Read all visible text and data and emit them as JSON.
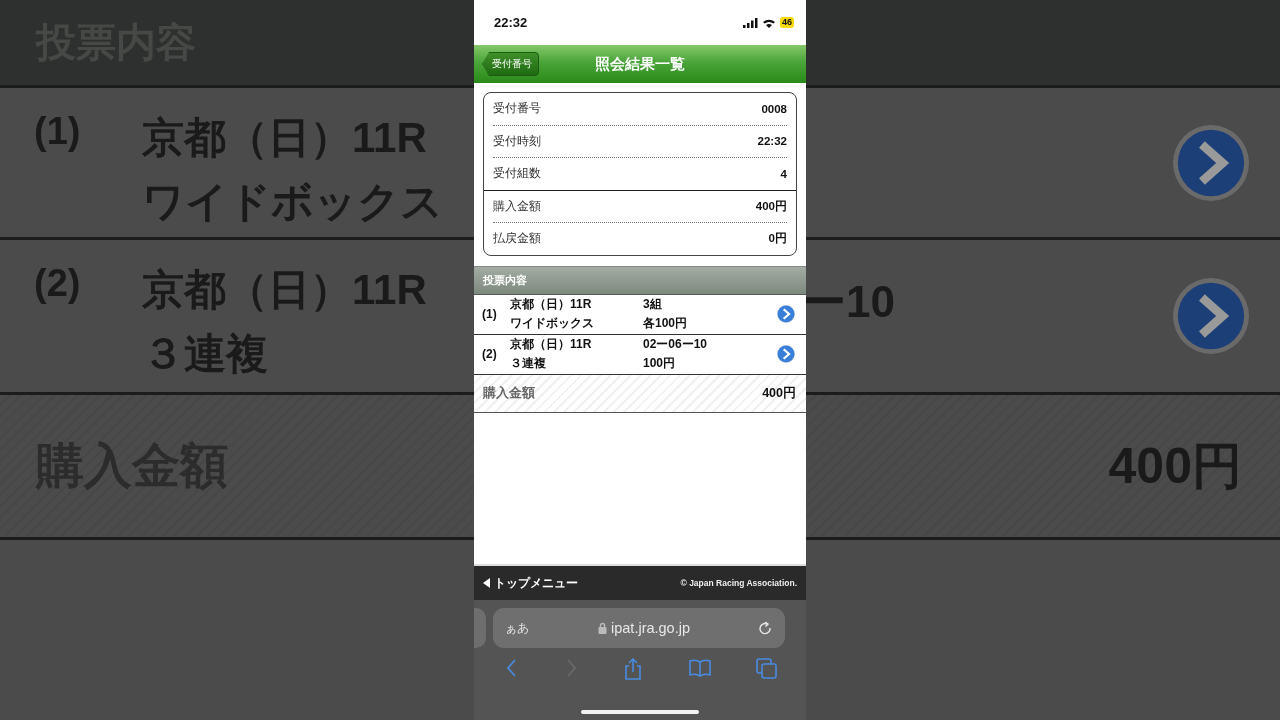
{
  "backdrop": {
    "left": {
      "header": "投票内容",
      "bets": [
        {
          "number": "(1)",
          "lines": [
            "京都（日）11R",
            "ワイドボックス"
          ]
        },
        {
          "number": "(2)",
          "lines": [
            "京都（日）11R",
            "３連複"
          ]
        }
      ],
      "total_label": "購入金額"
    },
    "right": {
      "second_bet_fragment": "ー10",
      "total_amount": "400円"
    }
  },
  "status_bar": {
    "time": "22:32",
    "battery": "46"
  },
  "nav_bar": {
    "back": "受付番号",
    "title": "照会結果一覧"
  },
  "summary": {
    "groups": [
      [
        {
          "label": "受付番号",
          "value": "0008"
        },
        {
          "label": "受付時刻",
          "value": "22:32"
        },
        {
          "label": "受付組数",
          "value": "4"
        }
      ],
      [
        {
          "label": "購入金額",
          "value": "400円"
        },
        {
          "label": "払戻金額",
          "value": "0円"
        }
      ]
    ]
  },
  "section_header": "投票内容",
  "bets": [
    {
      "number": "(1)",
      "venue": "京都（日）11R",
      "type": "ワイドボックス",
      "detail": "3組",
      "amount": "各100円"
    },
    {
      "number": "(2)",
      "venue": "京都（日）11R",
      "type": "３連複",
      "detail": "02ー06ー10",
      "amount": "100円"
    }
  ],
  "total": {
    "label": "購入金額",
    "value": "400円"
  },
  "footer": {
    "menu_link": "トップメニュー",
    "copyright": "© Japan Racing Association."
  },
  "browser": {
    "text_size": "ぁあ",
    "url": "ipat.jra.go.jp",
    "toolbar": [
      {
        "kind": "back",
        "disabled": false
      },
      {
        "kind": "forward",
        "disabled": true
      },
      {
        "kind": "share",
        "disabled": false
      },
      {
        "kind": "bookmarks",
        "disabled": false
      },
      {
        "kind": "tabs",
        "disabled": false
      }
    ]
  }
}
